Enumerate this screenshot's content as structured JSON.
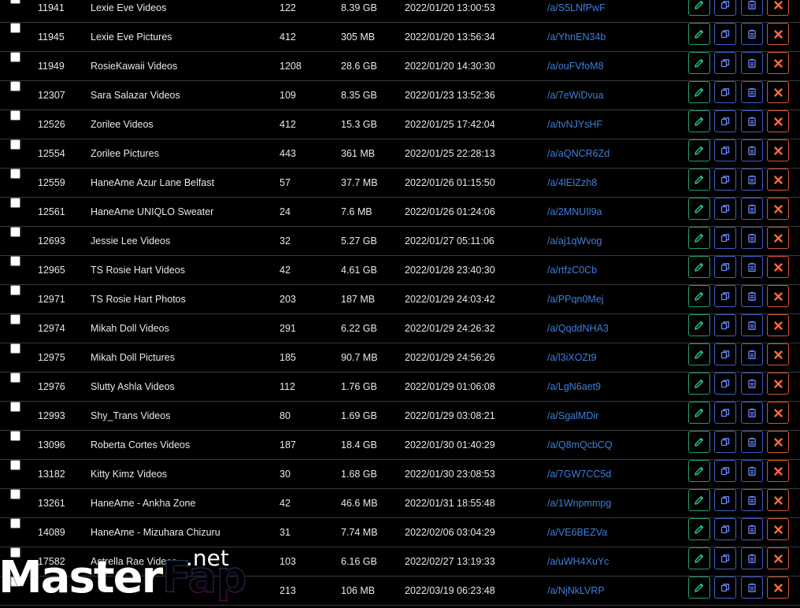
{
  "rows": [
    {
      "id": "11941",
      "name": "Lexie Eve Videos",
      "count": "122",
      "size": "8.39 GB",
      "date": "2022/01/20 13:00:53",
      "link": "/a/S5LNfPwF"
    },
    {
      "id": "11945",
      "name": "Lexie Eve Pictures",
      "count": "412",
      "size": "305 MB",
      "date": "2022/01/20 13:56:34",
      "link": "/a/YhnEN34b"
    },
    {
      "id": "11949",
      "name": "RosieKawaii Videos",
      "count": "1208",
      "size": "28.6 GB",
      "date": "2022/01/20 14:30:30",
      "link": "/a/ouFVfoM8"
    },
    {
      "id": "12307",
      "name": "Sara Salazar Videos",
      "count": "109",
      "size": "8.35 GB",
      "date": "2022/01/23 13:52:36",
      "link": "/a/7eWiDvua"
    },
    {
      "id": "12526",
      "name": "Zorilee Videos",
      "count": "412",
      "size": "15.3 GB",
      "date": "2022/01/25 17:42:04",
      "link": "/a/tvNJYsHF"
    },
    {
      "id": "12554",
      "name": "Zorilee Pictures",
      "count": "443",
      "size": "361 MB",
      "date": "2022/01/25 22:28:13",
      "link": "/a/aQNCR6Zd"
    },
    {
      "id": "12559",
      "name": "HaneAme Azur Lane Belfast",
      "count": "57",
      "size": "37.7 MB",
      "date": "2022/01/26 01:15:50",
      "link": "/a/4lEIZzh8"
    },
    {
      "id": "12561",
      "name": "HaneAme UNIQLO Sweater",
      "count": "24",
      "size": "7.6 MB",
      "date": "2022/01/26 01:24:06",
      "link": "/a/2MNUIl9a"
    },
    {
      "id": "12693",
      "name": "Jessie Lee Videos",
      "count": "32",
      "size": "5.27 GB",
      "date": "2022/01/27 05:11:06",
      "link": "/a/aj1qWvog"
    },
    {
      "id": "12965",
      "name": "TS Rosie Hart Videos",
      "count": "42",
      "size": "4.61 GB",
      "date": "2022/01/28 23:40:30",
      "link": "/a/rtfzC0Cb"
    },
    {
      "id": "12971",
      "name": "TS Rosie Hart Photos",
      "count": "203",
      "size": "187 MB",
      "date": "2022/01/29 24:03:42",
      "link": "/a/PPqn0Mej"
    },
    {
      "id": "12974",
      "name": "Mikah Doll Videos",
      "count": "291",
      "size": "6.22 GB",
      "date": "2022/01/29 24:26:32",
      "link": "/a/QqddNHA3"
    },
    {
      "id": "12975",
      "name": "Mikah Doll Pictures",
      "count": "185",
      "size": "90.7 MB",
      "date": "2022/01/29 24:56:26",
      "link": "/a/l3iXOZt9"
    },
    {
      "id": "12976",
      "name": "Slutty Ashla Videos",
      "count": "112",
      "size": "1.76 GB",
      "date": "2022/01/29 01:06:08",
      "link": "/a/LgN6aet9"
    },
    {
      "id": "12993",
      "name": "Shy_Trans Videos",
      "count": "80",
      "size": "1.69 GB",
      "date": "2022/01/29 03:08:21",
      "link": "/a/SgalMDir"
    },
    {
      "id": "13096",
      "name": "Roberta Cortes Videos",
      "count": "187",
      "size": "18.4 GB",
      "date": "2022/01/30 01:40:29",
      "link": "/a/Q8mQcbCQ"
    },
    {
      "id": "13182",
      "name": "Kitty Kimz Videos",
      "count": "30",
      "size": "1.68 GB",
      "date": "2022/01/30 23:08:53",
      "link": "/a/7GW7CC5d"
    },
    {
      "id": "13261",
      "name": "HaneAme - Ankha Zone",
      "count": "42",
      "size": "46.6 MB",
      "date": "2022/01/31 18:55:48",
      "link": "/a/1Wnpmmpg"
    },
    {
      "id": "14089",
      "name": "HaneAme - Mizuhara Chizuru",
      "count": "31",
      "size": "7.74 MB",
      "date": "2022/02/06 03:04:29",
      "link": "/a/VE6BEZVa"
    },
    {
      "id": "17582",
      "name": "Astrella Rae Videos",
      "count": "103",
      "size": "6.16 GB",
      "date": "2022/02/27 13:19:33",
      "link": "/a/uWH4XuYc"
    },
    {
      "id": "",
      "name": "",
      "count": "213",
      "size": "106 MB",
      "date": "2022/03/19 06:23:48",
      "link": "/a/NjNkLVRP"
    }
  ],
  "icons": {
    "edit": "pencil-icon",
    "copy": "copy-icon",
    "clipboard": "clipboard-icon",
    "delete": "close-icon"
  },
  "colors": {
    "background": "#000000",
    "link": "#3e7fd9",
    "edit": "#22c48f",
    "copy": "#6a87ff",
    "delete": "#ff6a3a"
  },
  "watermark": {
    "master": "Master",
    "fap": "Fap",
    "net": ".net"
  }
}
